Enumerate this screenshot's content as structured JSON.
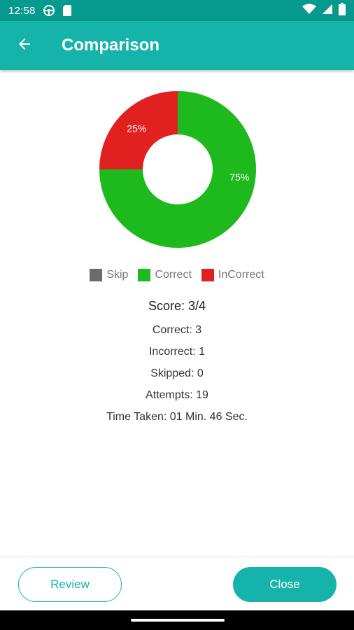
{
  "status_bar": {
    "time": "12:58",
    "icons": [
      "steering-wheel-icon",
      "sd-card-icon",
      "wifi-icon",
      "cell-signal-icon",
      "battery-icon"
    ]
  },
  "app_bar": {
    "title": "Comparison",
    "back_icon": "arrow-left-icon",
    "color": "#16b3aa"
  },
  "chart_data": {
    "type": "pie",
    "style": "donut",
    "slices": [
      {
        "name": "Correct",
        "value": 75,
        "label": "75%",
        "color": "#1db91d"
      },
      {
        "name": "InCorrect",
        "value": 25,
        "label": "25%",
        "color": "#e12020"
      },
      {
        "name": "Skip",
        "value": 0,
        "label": "",
        "color": "#6b6b6b"
      }
    ]
  },
  "legend": [
    {
      "label": "Skip",
      "color": "#6b6b6b"
    },
    {
      "label": "Correct",
      "color": "#1db91d"
    },
    {
      "label": "InCorrect",
      "color": "#e12020"
    }
  ],
  "stats": {
    "score": "Score: 3/4",
    "correct": "Correct: 3",
    "incorrect": "Incorrect: 1",
    "skipped": "Skipped: 0",
    "attempts": "Attempts: 19",
    "time_taken": "Time Taken: 01 Min. 46 Sec."
  },
  "buttons": {
    "review": "Review",
    "close": "Close"
  }
}
